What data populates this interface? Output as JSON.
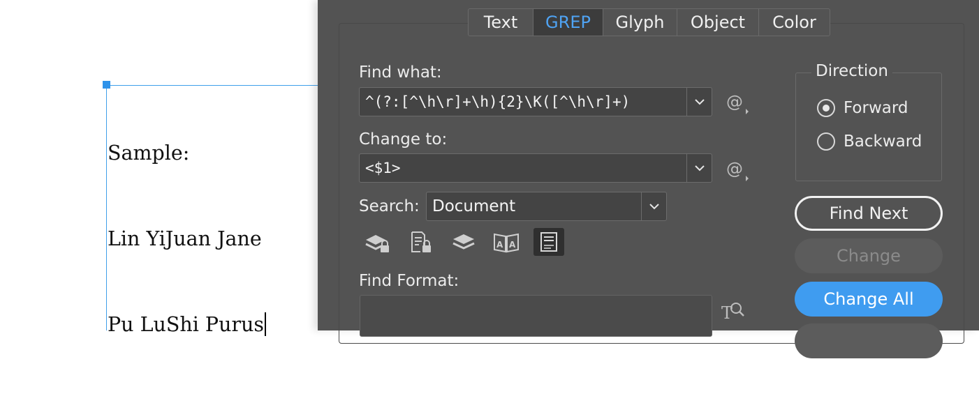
{
  "document": {
    "lines": [
      "Sample:",
      "Lin YiJuan Jane",
      "Pu LuShi Purus"
    ]
  },
  "dialog": {
    "tabs": [
      {
        "label": "Text",
        "active": false
      },
      {
        "label": "GREP",
        "active": true
      },
      {
        "label": "Glyph",
        "active": false
      },
      {
        "label": "Object",
        "active": false
      },
      {
        "label": "Color",
        "active": false
      }
    ],
    "find_what": {
      "label": "Find what:",
      "value": "^(?:[^\\h\\r]+\\h){2}\\K([^\\h\\r]+)"
    },
    "change_to": {
      "label": "Change to:",
      "value": "<$1>"
    },
    "search": {
      "label": "Search:",
      "value": "Document"
    },
    "option_icons": [
      {
        "name": "include-locked-layers-icon",
        "active": false
      },
      {
        "name": "include-locked-stories-icon",
        "active": false
      },
      {
        "name": "include-hidden-layers-icon",
        "active": false
      },
      {
        "name": "include-master-pages-icon",
        "active": false
      },
      {
        "name": "include-footnotes-icon",
        "active": true
      }
    ],
    "find_format": {
      "label": "Find Format:"
    },
    "direction": {
      "title": "Direction",
      "options": [
        {
          "label": "Forward",
          "selected": true
        },
        {
          "label": "Backward",
          "selected": false
        }
      ]
    },
    "buttons": {
      "find_next": "Find Next",
      "change": "Change",
      "change_all": "Change All"
    },
    "colors": {
      "panel_bg": "#535353",
      "active_tab_text": "#4fa3f3",
      "primary_button": "#3f9cf0",
      "frame_selection": "#3f9fea"
    }
  }
}
